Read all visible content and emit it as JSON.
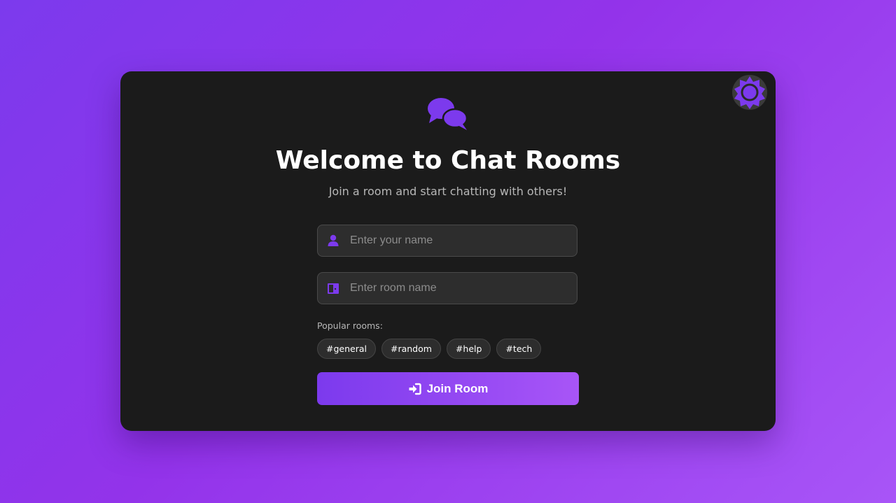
{
  "app": {
    "title": "Welcome to Chat Rooms",
    "subtitle": "Join a room and start chatting with others!"
  },
  "form": {
    "name_placeholder": "Enter your name",
    "name_value": "",
    "room_placeholder": "Enter room name",
    "room_value": ""
  },
  "popular": {
    "label": "Popular rooms:",
    "rooms": [
      "#general",
      "#random",
      "#help",
      "#tech"
    ]
  },
  "actions": {
    "join_label": "Join Room"
  },
  "icons": {
    "logo": "chat-bubbles-icon",
    "theme_toggle": "sun-icon",
    "name_field": "user-icon",
    "room_field": "door-icon",
    "join": "sign-in-icon"
  },
  "colors": {
    "accent": "#7c3aed",
    "accent_light": "#a855f7",
    "card": "#1b1b1b",
    "input_bg": "#2d2d2d"
  }
}
